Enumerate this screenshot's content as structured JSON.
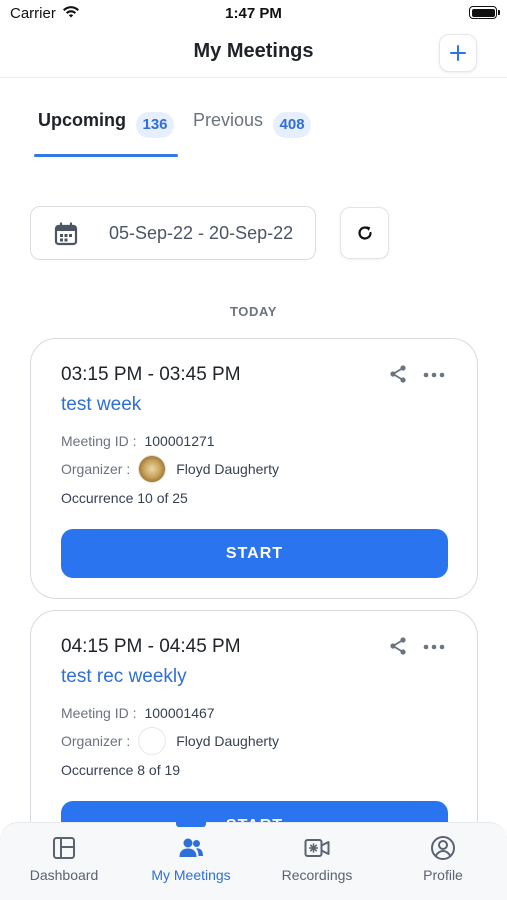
{
  "status_bar": {
    "carrier": "Carrier",
    "time": "1:47 PM"
  },
  "header": {
    "title": "My Meetings"
  },
  "tabs": [
    {
      "label": "Upcoming",
      "count": "136",
      "active": true
    },
    {
      "label": "Previous",
      "count": "408",
      "active": false
    }
  ],
  "filter": {
    "date_range": "05-Sep-22 - 20-Sep-22"
  },
  "section": {
    "label": "TODAY"
  },
  "meetings": [
    {
      "time": "03:15 PM - 03:45 PM",
      "title": "test week",
      "meeting_id_label": "Meeting ID :",
      "meeting_id": "100001271",
      "organizer_label": "Organizer :",
      "organizer": "Floyd Daugherty",
      "occurrence": "Occurrence 10 of 25",
      "action": "START"
    },
    {
      "time": "04:15 PM - 04:45 PM",
      "title": "test rec weekly",
      "meeting_id_label": "Meeting ID :",
      "meeting_id": "100001467",
      "organizer_label": "Organizer :",
      "organizer": "Floyd Daugherty",
      "occurrence": "Occurrence 8 of 19",
      "action": "START"
    }
  ],
  "bottom_nav": [
    {
      "label": "Dashboard",
      "icon": "dashboard-icon",
      "active": false
    },
    {
      "label": "My Meetings",
      "icon": "people-icon",
      "active": true
    },
    {
      "label": "Recordings",
      "icon": "video-icon",
      "active": false
    },
    {
      "label": "Profile",
      "icon": "profile-icon",
      "active": false
    }
  ],
  "colors": {
    "accent": "#2b74f0",
    "link": "#2f6fd6",
    "badge_bg": "#e7efff"
  }
}
